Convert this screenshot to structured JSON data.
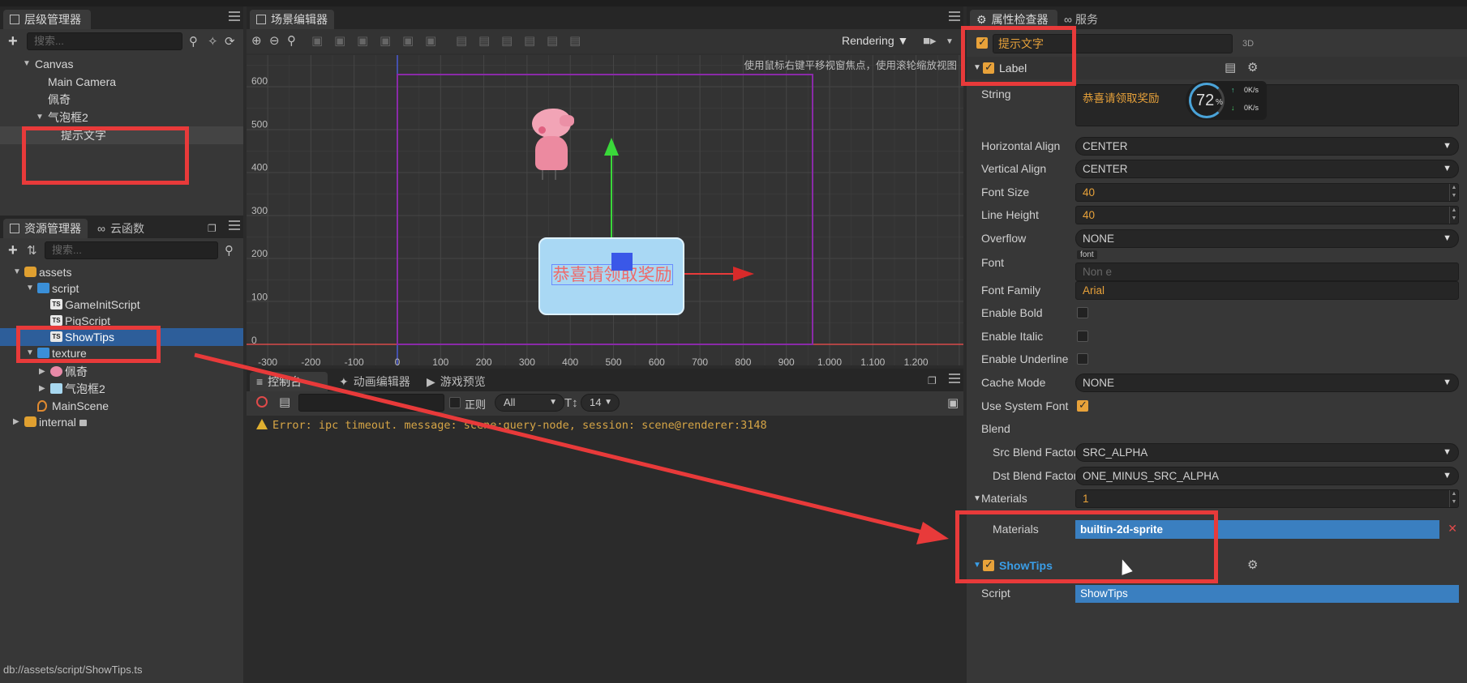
{
  "hierarchy": {
    "tab_label": "层级管理器",
    "search_placeholder": "搜索...",
    "nodes": [
      {
        "label": "Canvas"
      },
      {
        "label": "Main Camera"
      },
      {
        "label": "佩奇"
      },
      {
        "label": "气泡框2"
      },
      {
        "label": "提示文字"
      }
    ]
  },
  "assets": {
    "tab_label": "资源管理器",
    "tab2_label": "云函数",
    "search_placeholder": "搜索...",
    "nodes": [
      {
        "label": "assets"
      },
      {
        "label": "script"
      },
      {
        "label": "GameInitScript",
        "type": "TS"
      },
      {
        "label": "PigScript",
        "type": "TS"
      },
      {
        "label": "ShowTips",
        "type": "TS"
      },
      {
        "label": "texture"
      },
      {
        "label": "佩奇"
      },
      {
        "label": "气泡框2"
      },
      {
        "label": "MainScene"
      },
      {
        "label": "internal"
      }
    ],
    "status_path": "db://assets/script/ShowTips.ts"
  },
  "scene": {
    "tab_label": "场景编辑器",
    "render_mode": "Rendering",
    "hint": "使用鼠标右键平移视窗焦点，使用滚轮缩放视图",
    "y_ticks": [
      "600",
      "500",
      "400",
      "300",
      "200",
      "100",
      "0"
    ],
    "x_ticks": [
      "-300",
      "-200",
      "-100",
      "0",
      "100",
      "200",
      "300",
      "400",
      "500",
      "600",
      "700",
      "800",
      "900",
      "1,000",
      "1,100",
      "1,200"
    ],
    "bubble_text": "恭喜请领取奖励"
  },
  "console": {
    "tabs": [
      "控制台",
      "动画编辑器",
      "游戏预览"
    ],
    "regex_label": "正则",
    "level_filter": "All",
    "font_size": "14",
    "error_message": "Error: ipc timeout. message: scene:query-node, session: scene@renderer:3148"
  },
  "inspector": {
    "tab_label": "属性检查器",
    "tab2_label": "服务",
    "node_name": "提示文字",
    "mode_3d": "3D",
    "component_label": "Label",
    "string_label": "String",
    "string_value": "恭喜请领取奖励",
    "net_widget": {
      "percent": "72",
      "percent_sign": "%",
      "up": "0K/s",
      "down": "0K/s"
    },
    "props": [
      {
        "label": "Horizontal Align",
        "value": "CENTER",
        "kind": "select"
      },
      {
        "label": "Vertical Align",
        "value": "CENTER",
        "kind": "select"
      },
      {
        "label": "Font Size",
        "value": "40",
        "kind": "number"
      },
      {
        "label": "Line Height",
        "value": "40",
        "kind": "number"
      },
      {
        "label": "Overflow",
        "value": "NONE",
        "kind": "select"
      },
      {
        "label": "Font",
        "value": "Non e",
        "kind": "asset",
        "badge": "font"
      },
      {
        "label": "Font Family",
        "value": "Arial",
        "kind": "text"
      },
      {
        "label": "Enable Bold",
        "kind": "check",
        "checked": false
      },
      {
        "label": "Enable Italic",
        "kind": "check",
        "checked": false
      },
      {
        "label": "Enable Underline",
        "kind": "check",
        "checked": false
      },
      {
        "label": "Cache Mode",
        "value": "NONE",
        "kind": "select"
      },
      {
        "label": "Use System Font",
        "kind": "check",
        "checked": true
      },
      {
        "label": "Blend",
        "kind": "header"
      },
      {
        "label": "Src Blend Factor",
        "value": "SRC_ALPHA",
        "kind": "select"
      },
      {
        "label": "Dst Blend Factor",
        "value": "ONE_MINUS_SRC_ALPHA",
        "kind": "select"
      },
      {
        "label": "Materials",
        "value": "1",
        "kind": "number"
      },
      {
        "label": "Materials",
        "value": "builtin-2d-sprite",
        "kind": "material"
      }
    ],
    "component2_label": "ShowTips",
    "script_label": "Script",
    "script_value": "ShowTips"
  },
  "colors": {
    "accent": "#e8a23a",
    "selection": "#2d5e9a",
    "annotation_red": "#e83a3a"
  }
}
